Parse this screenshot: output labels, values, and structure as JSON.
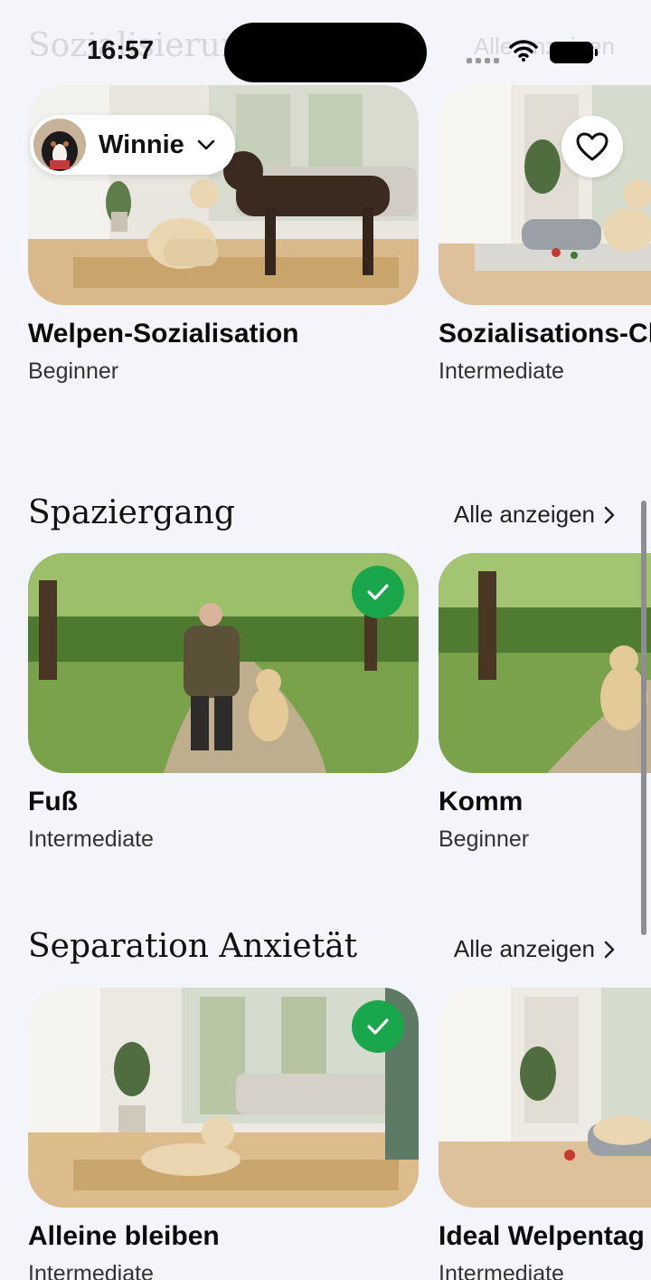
{
  "status_bar": {
    "time": "16:57"
  },
  "dog_selector": {
    "name": "Winnie"
  },
  "sections": [
    {
      "title": "Sozialisierung",
      "see_all": "Alle anzeigen",
      "cards": [
        {
          "title": "Welpen-Sozialisation",
          "level": "Beginner",
          "completed": false
        },
        {
          "title": "Sozialisations-Check",
          "level": "Intermediate",
          "completed": false,
          "favorite_button": true
        }
      ]
    },
    {
      "title": "Spaziergang",
      "see_all": "Alle anzeigen",
      "cards": [
        {
          "title": "Fuß",
          "level": "Intermediate",
          "completed": true
        },
        {
          "title": "Komm",
          "level": "Beginner",
          "completed": false
        }
      ]
    },
    {
      "title": "Separation Anxietät",
      "see_all": "Alle anzeigen",
      "cards": [
        {
          "title": "Alleine bleiben",
          "level": "Intermediate",
          "completed": true
        },
        {
          "title": "Ideal Welpentag",
          "level": "Intermediate",
          "completed": false
        }
      ]
    }
  ],
  "colors": {
    "background": "#f4f5fb",
    "check_green": "#1aa64a"
  }
}
